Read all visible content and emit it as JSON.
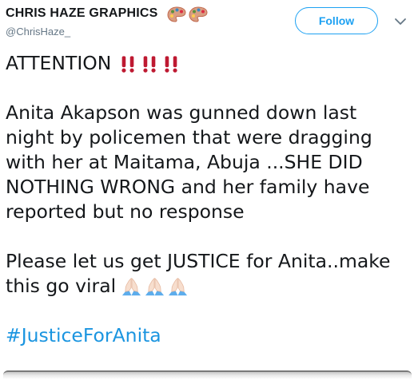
{
  "tweet": {
    "author": {
      "display_name": "CHRIS HAZE GRAPHICS",
      "name_emoji": [
        "artist-palette-icon",
        "artist-palette-icon"
      ],
      "handle": "@ChrisHaze_"
    },
    "follow_label": "Follow",
    "menu_icon": "chevron-down-icon",
    "lines": {
      "l1": "ATTENTION",
      "l1_emoji": [
        "double-exclamation-icon",
        "double-exclamation-icon",
        "double-exclamation-icon"
      ],
      "l2": "Anita Akapson was gunned down last",
      "l3": "night by policemen that were dragging",
      "l4": "with her at Maitama, Abuja ...SHE DID",
      "l5": "NOTHING WRONG and her family have",
      "l6": "reported but no response",
      "l7": "Please let us get JUSTICE for Anita..make",
      "l8": "this go viral",
      "l8_emoji": [
        "folded-hands-icon",
        "folded-hands-icon",
        "folded-hands-icon"
      ],
      "hashtag": "#JusticeForAnita"
    }
  },
  "colors": {
    "text": "#14171a",
    "secondary": "#657786",
    "accent": "#1da1f2",
    "hashtag": "#1b95e0",
    "exclamation": "#be1931"
  }
}
